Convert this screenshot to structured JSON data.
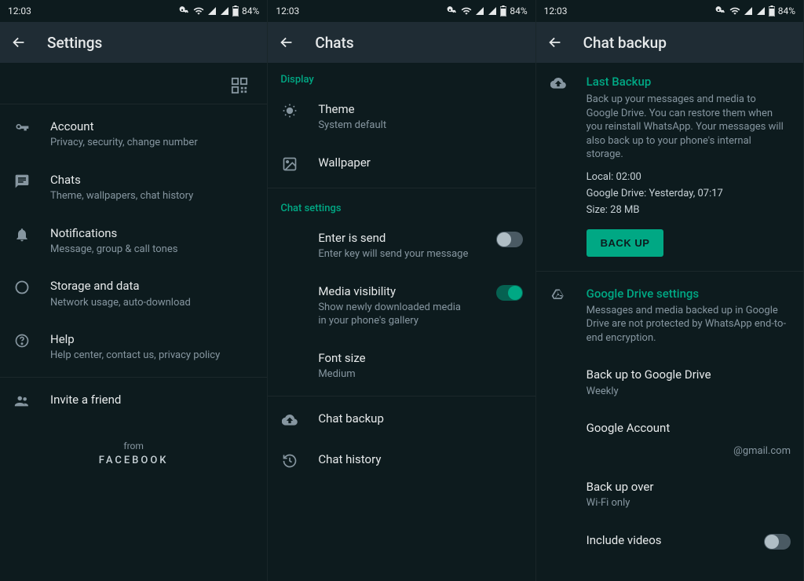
{
  "status": {
    "time": "12:03",
    "battery": "84%"
  },
  "p1": {
    "title": "Settings",
    "account": {
      "t": "Account",
      "s": "Privacy, security, change number"
    },
    "chats": {
      "t": "Chats",
      "s": "Theme, wallpapers, chat history"
    },
    "notif": {
      "t": "Notifications",
      "s": "Message, group & call tones"
    },
    "storage": {
      "t": "Storage and data",
      "s": "Network usage, auto-download"
    },
    "help": {
      "t": "Help",
      "s": "Help center, contact us, privacy policy"
    },
    "invite": {
      "t": "Invite a friend"
    },
    "from": "from",
    "facebook": "FACEBOOK"
  },
  "p2": {
    "title": "Chats",
    "display": "Display",
    "theme": {
      "t": "Theme",
      "s": "System default"
    },
    "wallpaper": {
      "t": "Wallpaper"
    },
    "chatsettings": "Chat settings",
    "enter": {
      "t": "Enter is send",
      "s": "Enter key will send your message"
    },
    "media": {
      "t": "Media visibility",
      "s": "Show newly downloaded media in your phone's gallery"
    },
    "font": {
      "t": "Font size",
      "s": "Medium"
    },
    "chatbackup": {
      "t": "Chat backup"
    },
    "chathistory": {
      "t": "Chat history"
    }
  },
  "p3": {
    "title": "Chat backup",
    "last": {
      "h": "Last Backup",
      "desc": "Back up your messages and media to Google Drive. You can restore them when you reinstall WhatsApp. Your messages will also back up to your phone's internal storage.",
      "local": "Local: 02:00",
      "gd": "Google Drive: Yesterday, 07:17",
      "size": "Size: 28 MB",
      "btn": "BACK UP"
    },
    "gds": {
      "h": "Google Drive settings",
      "desc": "Messages and media backed up in Google Drive are not protected by WhatsApp end-to-end encryption.",
      "freq_t": "Back up to Google Drive",
      "freq_v": "Weekly",
      "acct_t": "Google Account",
      "acct_v": "@gmail.com",
      "over_t": "Back up over",
      "over_v": "Wi-Fi only",
      "vid_t": "Include videos"
    }
  }
}
